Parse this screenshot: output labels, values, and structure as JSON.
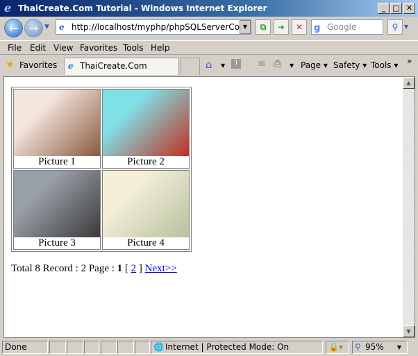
{
  "window": {
    "title": "ThaiCreate.Com Tutorial - Windows Internet Explorer",
    "min": "_",
    "max": "□",
    "close": "✕"
  },
  "nav": {
    "back": "←",
    "forward": "→",
    "url": "http://localhost/myphp/phpSQLServerColumnPagin",
    "search_placeholder": "Google"
  },
  "menu": [
    "File",
    "Edit",
    "View",
    "Favorites",
    "Tools",
    "Help"
  ],
  "favbar": {
    "favorites": "Favorites",
    "tab": "ThaiCreate.Com Tutorial",
    "page": "Page ▾",
    "safety": "Safety ▾",
    "tools": "Tools ▾",
    "more": "»"
  },
  "gallery": [
    {
      "caption": "Picture 1",
      "colors": [
        "#f3e6dc",
        "#8a5a40"
      ]
    },
    {
      "caption": "Picture 2",
      "colors": [
        "#7fe0e8",
        "#c23020"
      ]
    },
    {
      "caption": "Picture 3",
      "colors": [
        "#9aa0a8",
        "#3a3a3a"
      ]
    },
    {
      "caption": "Picture 4",
      "colors": [
        "#f4f0d8",
        "#b8c0a0"
      ]
    }
  ],
  "pager": {
    "summary": "Total 8 Record : 2 Page :",
    "current": "1",
    "open": "[",
    "page2": "2",
    "close": "]",
    "next": "Next>>"
  },
  "status": {
    "done": "Done",
    "zone": "Internet | Protected Mode: On",
    "zoom": "95%"
  }
}
